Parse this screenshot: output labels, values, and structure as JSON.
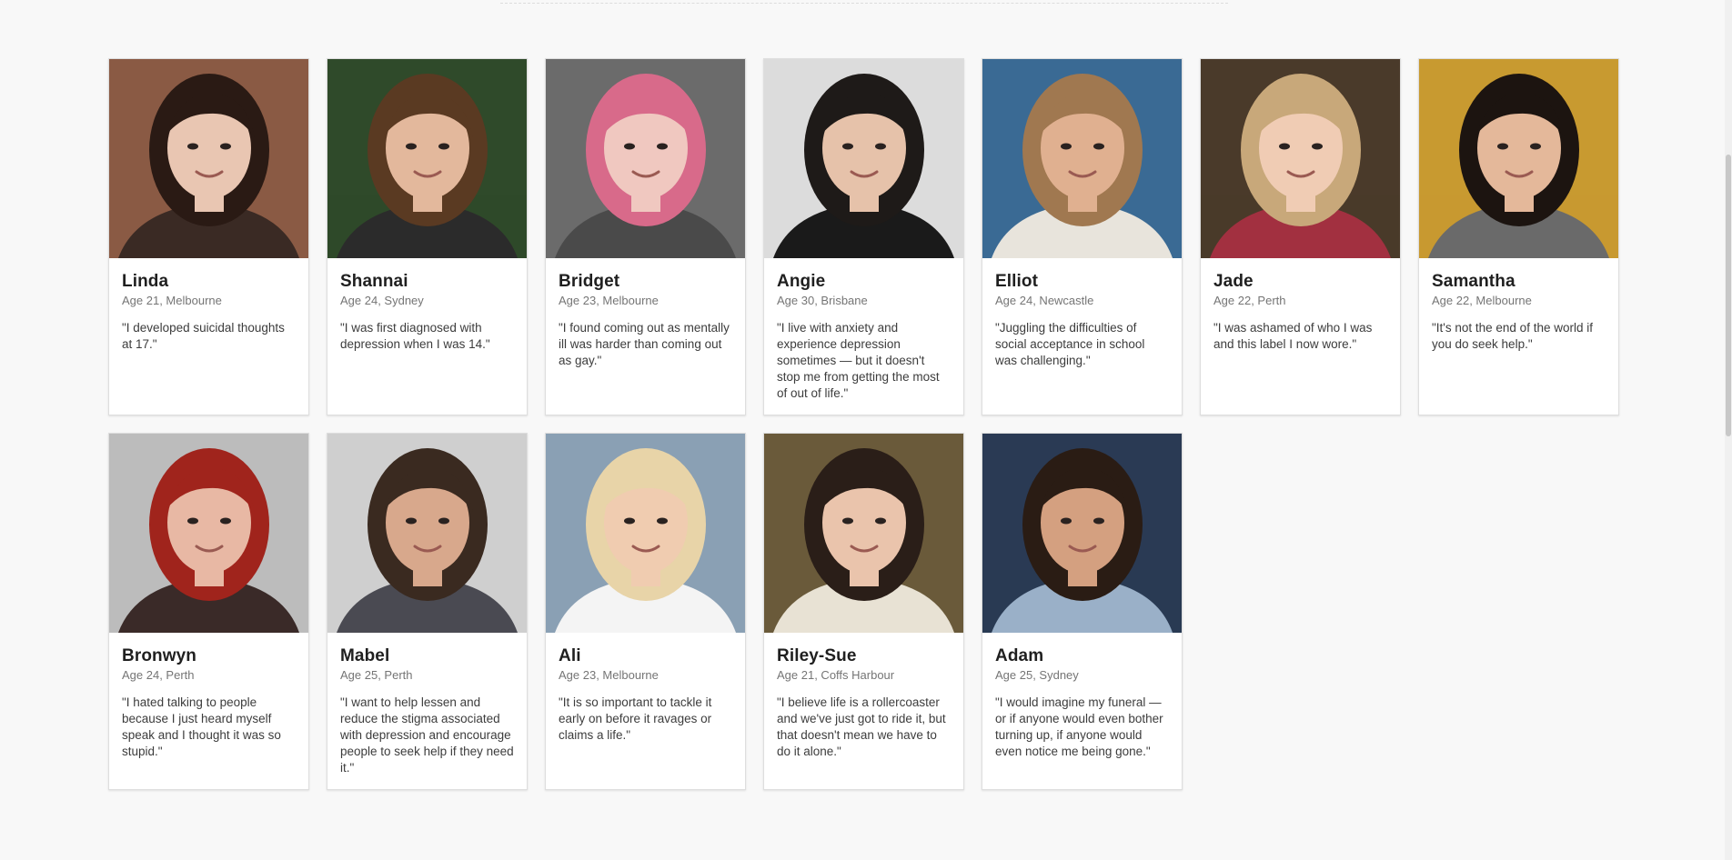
{
  "profiles": [
    {
      "name": "Linda",
      "meta": "Age 21, Melbourne",
      "quote": "\"I developed suicidal thoughts at 17.\"",
      "colors": {
        "bg": "#8a5a44",
        "hair": "#2a1a14",
        "skin": "#e9c6b2",
        "shirt": "#3a2a24"
      }
    },
    {
      "name": "Shannai",
      "meta": "Age 24, Sydney",
      "quote": "\"I was first diagnosed with depression when I was 14.\"",
      "colors": {
        "bg": "#2f4a2a",
        "hair": "#5a3a22",
        "skin": "#e3b89c",
        "shirt": "#2b2b2b"
      }
    },
    {
      "name": "Bridget",
      "meta": "Age 23, Melbourne",
      "quote": "\"I found coming out as mentally ill was harder than coming out as gay.\"",
      "colors": {
        "bg": "#6b6b6b",
        "hair": "#d86a8a",
        "skin": "#f0c8c0",
        "shirt": "#4a4a4a"
      }
    },
    {
      "name": "Angie",
      "meta": "Age 30, Brisbane",
      "quote": "\"I live with anxiety and experience depression sometimes — but it doesn't stop me from getting the most of out of life.\"",
      "colors": {
        "bg": "#dcdcdc",
        "hair": "#1e1a18",
        "skin": "#e6c2aa",
        "shirt": "#1a1a1a"
      }
    },
    {
      "name": "Elliot",
      "meta": "Age 24, Newcastle",
      "quote": "\"Juggling the difficulties of social acceptance in school was challenging.\"",
      "colors": {
        "bg": "#3a6a94",
        "hair": "#a07850",
        "skin": "#e0b090",
        "shirt": "#e8e4dc"
      }
    },
    {
      "name": "Jade",
      "meta": "Age 22, Perth",
      "quote": "\"I was ashamed of who I was and this label I now wore.\"",
      "colors": {
        "bg": "#4a3a2a",
        "hair": "#c8a87a",
        "skin": "#f0ccb4",
        "shirt": "#a23040"
      }
    },
    {
      "name": "Samantha",
      "meta": "Age 22, Melbourne",
      "quote": "\"It's not the end of the world if you do seek help.\"",
      "colors": {
        "bg": "#c89a30",
        "hair": "#1c1410",
        "skin": "#e4b89a",
        "shirt": "#6a6a6a"
      }
    },
    {
      "name": "Bronwyn",
      "meta": "Age 24, Perth",
      "quote": "\"I hated talking to people because I just heard myself speak and I thought it was so stupid.\"",
      "colors": {
        "bg": "#bcbcbc",
        "hair": "#a0241c",
        "skin": "#e8b8a4",
        "shirt": "#3a2a28"
      }
    },
    {
      "name": "Mabel",
      "meta": "Age 25, Perth",
      "quote": "\"I want to help lessen and reduce the stigma associated with depression and encourage people to seek help if they need it.\"",
      "colors": {
        "bg": "#cfcfcf",
        "hair": "#3a2a20",
        "skin": "#d8a88c",
        "shirt": "#4a4a52"
      }
    },
    {
      "name": "Ali",
      "meta": "Age 23, Melbourne",
      "quote": "\"It is so important to tackle it early on before it ravages or claims a life.\"",
      "colors": {
        "bg": "#8aa0b4",
        "hair": "#e8d4a8",
        "skin": "#f0ccb0",
        "shirt": "#f4f4f4"
      }
    },
    {
      "name": "Riley-Sue",
      "meta": "Age 21, Coffs Harbour",
      "quote": "\"I believe life is a rollercoaster and we've just got to ride it, but that doesn't mean we have to do it alone.\"",
      "colors": {
        "bg": "#6a5a3a",
        "hair": "#2a1e18",
        "skin": "#eac4ac",
        "shirt": "#e8e2d4"
      }
    },
    {
      "name": "Adam",
      "meta": "Age 25, Sydney",
      "quote": "\"I would imagine my funeral — or if anyone would even bother turning up, if anyone would even notice me being gone.\"",
      "colors": {
        "bg": "#2a3a54",
        "hair": "#2a1c14",
        "skin": "#d4a080",
        "shirt": "#9ab0c8"
      }
    }
  ]
}
